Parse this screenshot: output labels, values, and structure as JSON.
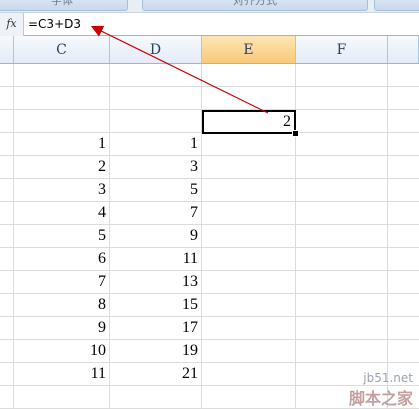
{
  "ribbon": {
    "groups": [
      "字体",
      "对齐方式",
      ""
    ]
  },
  "formula_bar": {
    "fx_label": "fx",
    "formula": "=C3+D3"
  },
  "columns": [
    {
      "label": ""
    },
    {
      "label": "C"
    },
    {
      "label": "D"
    },
    {
      "label": "E",
      "selected": true
    },
    {
      "label": "F"
    },
    {
      "label": ""
    }
  ],
  "rows": [
    {
      "c": "",
      "d": ""
    },
    {
      "c": "",
      "d": ""
    },
    {
      "c": "",
      "d": ""
    },
    {
      "c": "1",
      "d": "1"
    },
    {
      "c": "2",
      "d": "3"
    },
    {
      "c": "3",
      "d": "5"
    },
    {
      "c": "4",
      "d": "7"
    },
    {
      "c": "5",
      "d": "9"
    },
    {
      "c": "6",
      "d": "11"
    },
    {
      "c": "7",
      "d": "13"
    },
    {
      "c": "8",
      "d": "15"
    },
    {
      "c": "9",
      "d": "17"
    },
    {
      "c": "10",
      "d": "19"
    },
    {
      "c": "11",
      "d": "21"
    },
    {
      "c": "",
      "d": ""
    }
  ],
  "active_cell": {
    "value": "2"
  },
  "annotation": {
    "color": "#cc0000"
  },
  "watermark": {
    "top": "jb51.net",
    "bottom": "脚本之家"
  }
}
